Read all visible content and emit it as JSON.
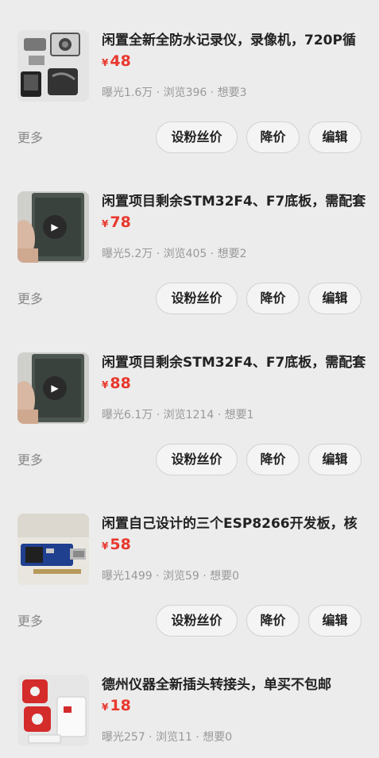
{
  "items": [
    {
      "title": "闲置全新全防水记录仪，录像机，720P循",
      "currency": "¥",
      "price": "48",
      "stats": "曝光1.6万 · 浏览396 · 想要3",
      "more": "更多",
      "buttons": {
        "fans_price": "设粉丝价",
        "price_drop": "降价",
        "edit": "编辑"
      },
      "has_video": false,
      "thumb": "camera-kit-photo"
    },
    {
      "title": "闲置项目剩余STM32F4、F7底板，需配套",
      "currency": "¥",
      "price": "78",
      "stats": "曝光5.2万 · 浏览405 · 想要2",
      "more": "更多",
      "buttons": {
        "fans_price": "设粉丝价",
        "price_drop": "降价",
        "edit": "编辑"
      },
      "has_video": true,
      "thumb": "lcd-board-video"
    },
    {
      "title": "闲置项目剩余STM32F4、F7底板，需配套",
      "currency": "¥",
      "price": "88",
      "stats": "曝光6.1万 · 浏览1214 · 想要1",
      "more": "更多",
      "buttons": {
        "fans_price": "设粉丝价",
        "price_drop": "降价",
        "edit": "编辑"
      },
      "has_video": true,
      "thumb": "lcd-board-video"
    },
    {
      "title": "闲置自己设计的三个ESP8266开发板，核",
      "currency": "¥",
      "price": "58",
      "stats": "曝光1499 · 浏览59 · 想要0",
      "more": "更多",
      "buttons": {
        "fans_price": "设粉丝价",
        "price_drop": "降价",
        "edit": "编辑"
      },
      "has_video": false,
      "thumb": "esp8266-board-photo"
    },
    {
      "title": "德州仪器全新插头转接头，单买不包邮",
      "currency": "¥",
      "price": "18",
      "stats": "曝光257 · 浏览11 · 想要0",
      "has_video": false,
      "thumb": "plug-adapter-photo"
    }
  ],
  "colors": {
    "background": "#ececec",
    "price": "#e8382e",
    "title": "#222222",
    "meta": "#999999",
    "button_border": "#d2d2d2"
  },
  "icons": {
    "play": "play-icon"
  }
}
